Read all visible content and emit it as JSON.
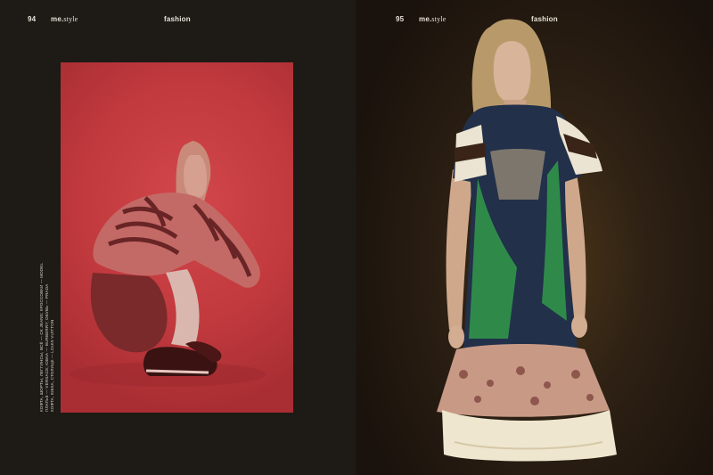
{
  "left_page": {
    "page_number": "94",
    "brand_me": "me.",
    "brand_style": "style",
    "section": "fashion",
    "credits": [
      "КОФТА, ШОРТЫ, ЛЕГГИНСЫ, ВСЁ — CK JEANS; КРОССОВКИ — MODEL",
      "ПЛАТЬЕ — VERSACE; ЮБКА — BURBERRY; ОБУВЬ — PRADA",
      "КОФТА, ЮБКА, СТОЛИЦЕ — LOUIS VUITTON"
    ]
  },
  "right_page": {
    "page_number": "95",
    "brand_me": "me.",
    "brand_style": "style",
    "section": "fashion"
  }
}
